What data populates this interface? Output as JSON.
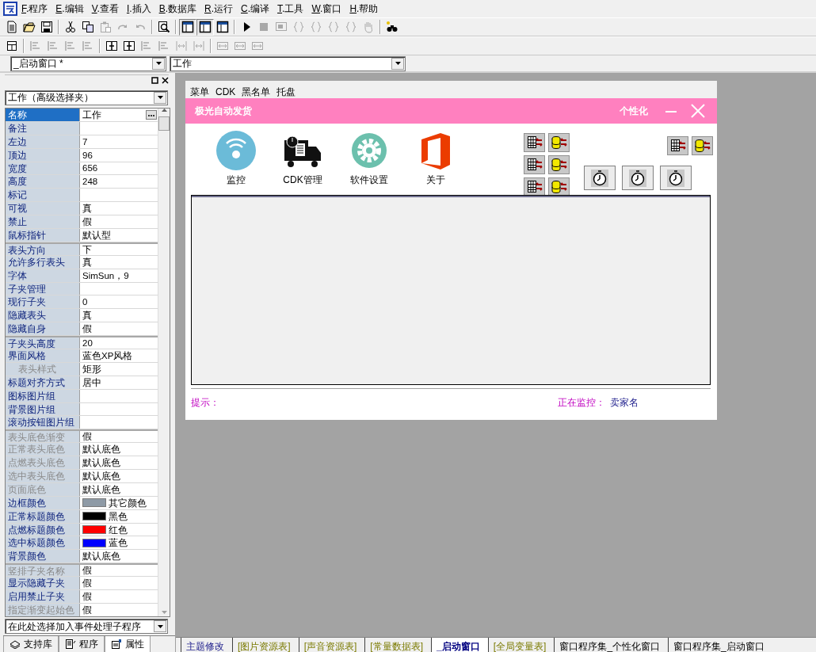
{
  "menu": [
    {
      "key": "F",
      "label": ".程序"
    },
    {
      "key": "E",
      "label": ".编辑"
    },
    {
      "key": "V",
      "label": ".查看"
    },
    {
      "key": "I",
      "label": ".插入"
    },
    {
      "key": "B",
      "label": ".数据库"
    },
    {
      "key": "R",
      "label": ".运行"
    },
    {
      "key": "C",
      "label": ".编译"
    },
    {
      "key": "T",
      "label": ".工具"
    },
    {
      "key": "W",
      "label": ".窗口"
    },
    {
      "key": "H",
      "label": ".帮助"
    }
  ],
  "toolbar_1": [
    {
      "disabled": false,
      "pressed": false
    },
    {
      "disabled": false,
      "pressed": false
    },
    {
      "disabled": false,
      "pressed": false
    },
    {
      "disabled": false,
      "pressed": false
    },
    {
      "disabled": false,
      "pressed": false
    },
    {
      "disabled": true,
      "pressed": false
    },
    {
      "disabled": true,
      "pressed": false
    },
    {
      "disabled": true,
      "pressed": false
    },
    {
      "disabled": false,
      "pressed": false
    },
    {
      "disabled": false,
      "pressed": true
    },
    {
      "disabled": false,
      "pressed": true
    },
    {
      "disabled": false,
      "pressed": false
    },
    {
      "disabled": false,
      "pressed": false
    },
    {
      "disabled": true,
      "pressed": false
    },
    {
      "disabled": true,
      "pressed": false
    },
    {
      "disabled": true,
      "pressed": false
    },
    {
      "disabled": true,
      "pressed": false
    },
    {
      "disabled": true,
      "pressed": false
    },
    {
      "disabled": true,
      "pressed": false
    },
    {
      "disabled": true,
      "pressed": false
    },
    {
      "disabled": false,
      "pressed": false
    }
  ],
  "toolbar_2": [
    {
      "disabled": false
    },
    {
      "disabled": true
    },
    {
      "disabled": true
    },
    {
      "disabled": true
    },
    {
      "disabled": true
    },
    {
      "disabled": false
    },
    {
      "disabled": false
    },
    {
      "disabled": true
    },
    {
      "disabled": true
    },
    {
      "disabled": true
    },
    {
      "disabled": true
    },
    {
      "disabled": true
    },
    {
      "disabled": true
    },
    {
      "disabled": true
    }
  ],
  "window_selector": {
    "value": "_启动窗口 *"
  },
  "control_selector": {
    "value": "工作"
  },
  "properties_panel": {
    "component": "工作（高级选择夹）",
    "groups": [
      {
        "rows": [
          {
            "name": "名称",
            "value": "工作",
            "selected": true,
            "disabled": false
          },
          {
            "name": "备注",
            "selected": false,
            "disabled": false
          },
          {
            "name": "左边",
            "value": "7",
            "selected": false,
            "disabled": false
          },
          {
            "name": "顶边",
            "value": "96",
            "selected": false,
            "disabled": false
          },
          {
            "name": "宽度",
            "value": "656",
            "selected": false,
            "disabled": false
          },
          {
            "name": "高度",
            "value": "248",
            "selected": false,
            "disabled": false
          },
          {
            "name": "标记",
            "selected": false,
            "disabled": false
          },
          {
            "name": "可视",
            "value": "真",
            "selected": false,
            "disabled": false
          },
          {
            "name": "禁止",
            "value": "假",
            "selected": false,
            "disabled": false
          },
          {
            "name": "鼠标指针",
            "value": "默认型",
            "selected": false,
            "disabled": false
          }
        ]
      },
      {
        "rows": [
          {
            "name": "表头方向",
            "value": "下",
            "selected": false,
            "disabled": false
          },
          {
            "name": "允许多行表头",
            "value": "真",
            "selected": false,
            "disabled": false
          },
          {
            "name": "字体",
            "value": "SimSun，9",
            "selected": false,
            "disabled": false
          },
          {
            "name": "子夹管理",
            "selected": false,
            "disabled": false
          },
          {
            "name": "现行子夹",
            "value": "0",
            "selected": false,
            "disabled": false
          },
          {
            "name": "隐藏表头",
            "value": "真",
            "selected": false,
            "disabled": false
          },
          {
            "name": "隐藏自身",
            "value": "假",
            "selected": false,
            "disabled": false
          }
        ]
      },
      {
        "rows": [
          {
            "name": "子夹头高度",
            "value": "20",
            "selected": false,
            "disabled": false
          },
          {
            "name": "界面风格",
            "value": "蓝色XP风格",
            "selected": false,
            "disabled": false,
            "children": [
              {
                "name": "表头样式",
                "value": "矩形",
                "selected": false,
                "disabled": true
              }
            ]
          },
          {
            "name": "标题对齐方式",
            "value": "居中",
            "selected": false,
            "disabled": false
          },
          {
            "name": "图标图片组",
            "selected": false,
            "disabled": false
          },
          {
            "name": "背景图片组",
            "selected": false,
            "disabled": false
          },
          {
            "name": "滚动按钮图片组",
            "selected": false,
            "disabled": false
          }
        ]
      },
      {
        "rows": [
          {
            "name": "表头底色渐变",
            "value": "假",
            "selected": false,
            "disabled": true
          },
          {
            "name": "正常表头底色",
            "value": "默认底色",
            "selected": false,
            "disabled": true
          },
          {
            "name": "点燃表头底色",
            "value": "默认底色",
            "selected": false,
            "disabled": true
          },
          {
            "name": "选中表头底色",
            "value": "默认底色",
            "selected": false,
            "disabled": true
          },
          {
            "name": "页面底色",
            "value": "默认底色",
            "selected": false,
            "disabled": true
          },
          {
            "name": "边框颜色",
            "value": "其它颜色",
            "color": "#8e9aa6",
            "selected": false,
            "disabled": false
          },
          {
            "name": "正常标题颜色",
            "value": "黑色",
            "color": "#000000",
            "selected": false,
            "disabled": false
          },
          {
            "name": "点燃标题颜色",
            "value": "红色",
            "color": "#ff0000",
            "selected": false,
            "disabled": false
          },
          {
            "name": "选中标题颜色",
            "value": "蓝色",
            "color": "#0000ff",
            "selected": false,
            "disabled": false
          },
          {
            "name": "背景颜色",
            "value": "默认底色",
            "selected": false,
            "disabled": false
          }
        ]
      },
      {
        "rows": [
          {
            "name": "竖排子夹名称",
            "value": "假",
            "selected": false,
            "disabled": true
          },
          {
            "name": "显示隐藏子夹",
            "value": "假",
            "selected": false,
            "disabled": false
          },
          {
            "name": "启用禁止子夹",
            "value": "假",
            "selected": false,
            "disabled": false
          },
          {
            "name": "指定渐变起始色",
            "value": "假",
            "selected": false,
            "disabled": true
          }
        ]
      }
    ],
    "event_selector": "在此处选择加入事件处理子程序",
    "tabs": [
      {
        "label": "支持库",
        "selected": false
      },
      {
        "label": "程序",
        "selected": false
      },
      {
        "label": "属性",
        "selected": true
      }
    ]
  },
  "designer": {
    "menu": [
      "菜单",
      "CDK",
      "黑名单",
      "托盘"
    ],
    "title": "极光自动发货",
    "personalize": "个性化",
    "tool_buttons": [
      {
        "label": "监控"
      },
      {
        "label": "CDK管理"
      },
      {
        "label": "软件设置"
      },
      {
        "label": "关于"
      }
    ],
    "hint_label": "提示：",
    "monitor_label": "正在监控：",
    "monitor_value": "卖家名"
  },
  "document_tabs": [
    {
      "label": "主题修改",
      "kind": "theme",
      "selected": false
    },
    {
      "label": "[图片资源表]",
      "kind": "resource",
      "selected": false
    },
    {
      "label": "[声音资源表]",
      "kind": "resource",
      "selected": false
    },
    {
      "label": "[常量数据表]",
      "kind": "resource",
      "selected": false
    },
    {
      "label": "_启动窗口",
      "kind": "window",
      "selected": true
    },
    {
      "label": "[全局变量表]",
      "kind": "resource",
      "selected": false
    },
    {
      "label": "窗口程序集_个性化窗口",
      "kind": "code",
      "selected": false
    },
    {
      "label": "窗口程序集_启动窗口",
      "kind": "code",
      "selected": false
    }
  ]
}
